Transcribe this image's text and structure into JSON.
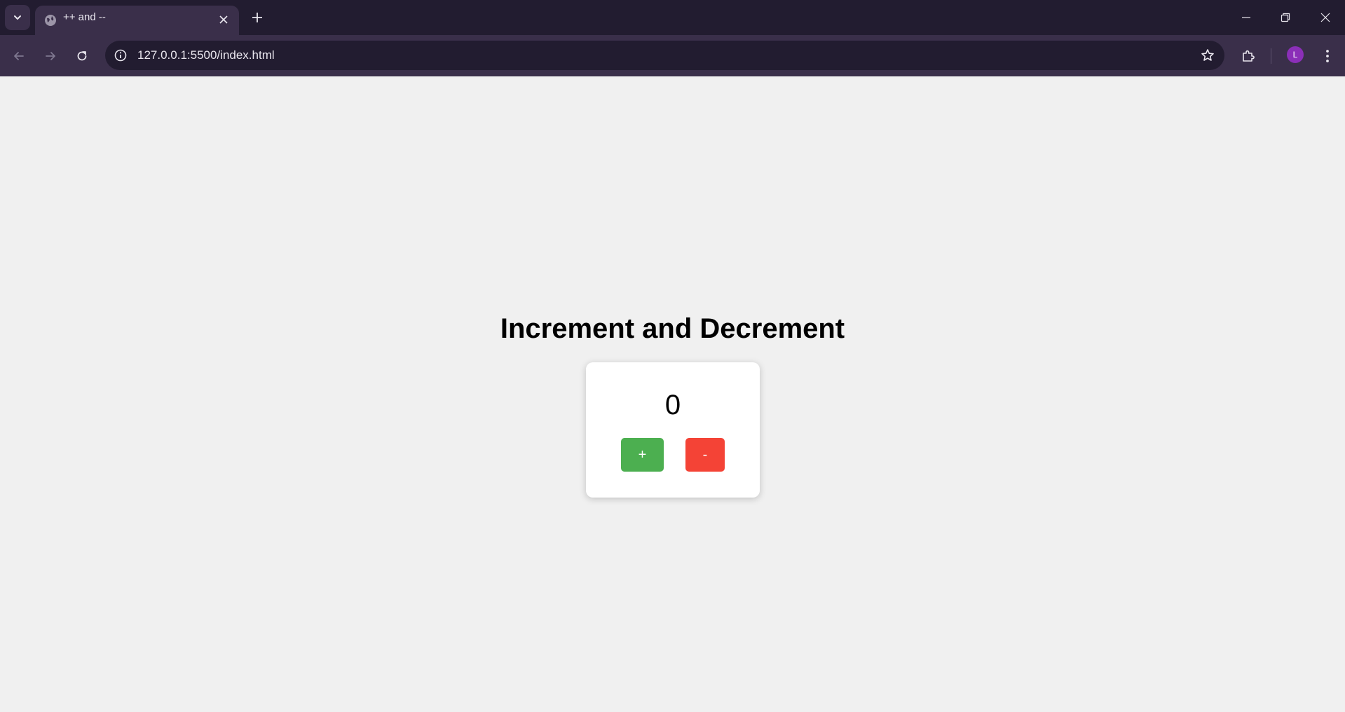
{
  "browser": {
    "tab": {
      "title": "++ and --",
      "favicon": "globe-icon"
    },
    "address_bar": {
      "url": "127.0.0.1:5500/index.html"
    },
    "profile": {
      "initial": "L",
      "color": "#8b2fb8"
    }
  },
  "page": {
    "heading": "Increment and Decrement",
    "counter": {
      "value": "0",
      "increment_label": "+",
      "decrement_label": "-",
      "increment_color": "#4caf50",
      "decrement_color": "#f44336"
    },
    "background": "#f0f0f0"
  }
}
